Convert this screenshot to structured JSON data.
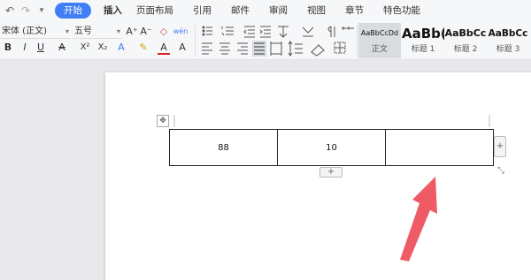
{
  "quick_access": {
    "undo": "↶",
    "redo": "↷",
    "more": "▾"
  },
  "tabs": [
    {
      "label": "开始",
      "active": true
    },
    {
      "label": "插入",
      "bold": true
    },
    {
      "label": "页面布局"
    },
    {
      "label": "引用"
    },
    {
      "label": "邮件"
    },
    {
      "label": "审阅"
    },
    {
      "label": "视图"
    },
    {
      "label": "章节"
    },
    {
      "label": "特色功能"
    }
  ],
  "ribbon": {
    "font_name": "宋体 (正文)",
    "font_size": "五号",
    "grow_font": "A⁺",
    "shrink_font": "A⁻",
    "clear_format": "◇",
    "pinyin": "wén",
    "bold": "B",
    "italic": "I",
    "underline": "U",
    "strike": "A",
    "superscript": "X²",
    "subscript": "X₂",
    "text_effect": "A",
    "highlight": "✎",
    "font_color": "A",
    "border": "A"
  },
  "styles": [
    {
      "sample": "AaBbCcDd",
      "label": "正文",
      "selected": true
    },
    {
      "sample": "AaBb(",
      "label": "标题 1"
    },
    {
      "sample": "AaBbCc",
      "label": "标题 2"
    },
    {
      "sample": "AaBbCc",
      "label": "标题 3"
    }
  ],
  "table": {
    "cells": [
      "88",
      "10",
      ""
    ]
  },
  "handles": {
    "move": "✥",
    "add": "+",
    "resize": "⤡"
  },
  "colors": {
    "accent": "#3f7ef3",
    "arrow": "#ee5b64"
  }
}
